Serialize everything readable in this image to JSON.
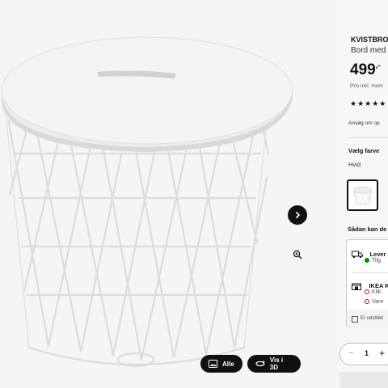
{
  "product": {
    "name": "KVISTBRO",
    "description": "Bord med",
    "price": "499",
    "price_suffix": ",-",
    "price_note": "Pris inkl. mom",
    "rating_stars": "★★★★★",
    "installment_link": "Ansøg om op"
  },
  "colour": {
    "heading": "Vælg farve",
    "value": "Hvid"
  },
  "purchase": {
    "heading": "Sådan kan de",
    "delivery_label": "Lever",
    "delivery_status": "Tilg",
    "delivery_status_color": "#0a8a00",
    "store_label": "IKEA K",
    "store_option_1": "Klik",
    "store_option_2": "Vare",
    "unavailable_color": "#cc0008",
    "display_note": "Er udstillet"
  },
  "quantity": {
    "minus": "−",
    "value": "1",
    "plus": "+"
  },
  "gallery": {
    "all_button": "Alle",
    "view_3d_button": "Vis i 3D",
    "next_icon": "chevron-right-icon",
    "zoom_icon": "zoom-in-icon"
  }
}
